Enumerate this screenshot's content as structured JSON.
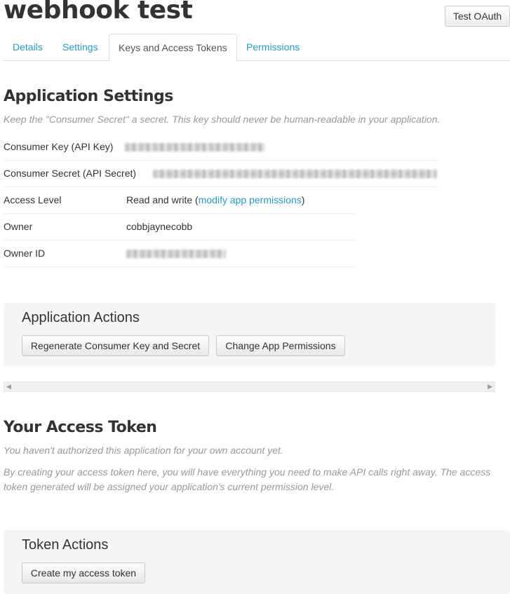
{
  "app": {
    "title": "webhook test",
    "test_oauth_label": "Test OAuth"
  },
  "tabs": [
    {
      "label": "Details"
    },
    {
      "label": "Settings"
    },
    {
      "label": "Keys and Access Tokens",
      "active": true
    },
    {
      "label": "Permissions"
    }
  ],
  "app_settings": {
    "heading": "Application Settings",
    "note": "Keep the \"Consumer Secret\" a secret. This key should never be human-readable in your application.",
    "rows": [
      {
        "label": "Consumer Key (API Key)",
        "value": ""
      },
      {
        "label": "Consumer Secret (API Secret)",
        "value": ""
      },
      {
        "label": "Access Level",
        "value": "Read and write (",
        "link": "modify app permissions",
        "suffix": ")"
      },
      {
        "label": "Owner",
        "value": "cobbjaynecobb"
      },
      {
        "label": "Owner ID",
        "value": ""
      }
    ]
  },
  "app_actions": {
    "title": "Application Actions",
    "regenerate_label": "Regenerate Consumer Key and Secret",
    "change_permissions_label": "Change App Permissions"
  },
  "access_token": {
    "heading": "Your Access Token",
    "note1": "You haven't authorized this application for your own account yet.",
    "note2": "By creating your access token here, you will have everything you need to make API calls right away. The access token generated will be assigned your application's current permission level."
  },
  "token_actions": {
    "title": "Token Actions",
    "create_label": "Create my access token"
  },
  "icons": {
    "scroll_left": "scroll-left-arrow",
    "scroll_right": "scroll-right-arrow"
  },
  "colors": {
    "link": "#2b9bc1",
    "muted_text": "#999999",
    "panel_bg": "#f5f5f5"
  }
}
